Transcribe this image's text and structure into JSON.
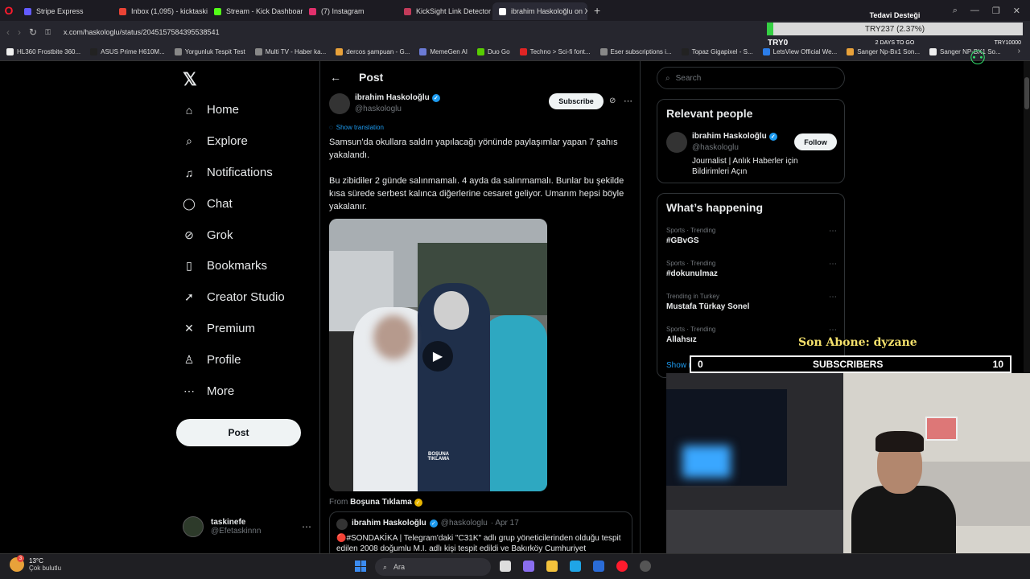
{
  "browser": {
    "tabs": [
      {
        "label": "Stripe Express",
        "color": "#635bff"
      },
      {
        "label": "Inbox (1,095) - kicktaskin...",
        "color": "#ea4335"
      },
      {
        "label": "Stream - Kick Dashboard",
        "color": "#53fc18"
      },
      {
        "label": "(7) Instagram",
        "color": "#e1306c"
      },
      {
        "label": "KickSight Link Detector",
        "color": "#c23b5a"
      },
      {
        "label": "ibrahim Haskoloğlu on X:",
        "color": "#ffffff",
        "active": true
      }
    ],
    "url": "x.com/haskologlu/status/2045157584395538541",
    "bookmarks": [
      {
        "label": "HL360 Frostbite 360...",
        "color": "#f0f0f0"
      },
      {
        "label": "ASUS Prime H610M...",
        "color": "#222"
      },
      {
        "label": "Yorgunluk Tespit Test",
        "color": "#888"
      },
      {
        "label": "Multi TV - Haber ka...",
        "color": "#888"
      },
      {
        "label": "dercos şampuan - G...",
        "color": "#e8a13a"
      },
      {
        "label": "MemeGen AI",
        "color": "#6b7bd6"
      },
      {
        "label": "Duo Go",
        "color": "#58cc02"
      },
      {
        "label": "Techno > Sci-fi font...",
        "color": "#e02424"
      },
      {
        "label": "Eser subscriptions i...",
        "color": "#888"
      },
      {
        "label": "Topaz Gigapixel - S...",
        "color": "#222"
      },
      {
        "label": "LetsView Official We...",
        "color": "#2b7de9"
      },
      {
        "label": "Sanger Np-Bx1 Son...",
        "color": "#e8a13a"
      },
      {
        "label": "Sanger NP-BX1 So...",
        "color": "#eee"
      }
    ]
  },
  "sidebar": {
    "items": [
      {
        "label": "Home",
        "icon": "⌂"
      },
      {
        "label": "Explore",
        "icon": "⌕"
      },
      {
        "label": "Notifications",
        "icon": "♫"
      },
      {
        "label": "Chat",
        "icon": "◯"
      },
      {
        "label": "Grok",
        "icon": "⊘"
      },
      {
        "label": "Bookmarks",
        "icon": "▯"
      },
      {
        "label": "Creator Studio",
        "icon": "➚"
      },
      {
        "label": "Premium",
        "icon": "✕"
      },
      {
        "label": "Profile",
        "icon": "♙"
      },
      {
        "label": "More",
        "icon": "⋯"
      }
    ],
    "post_label": "Post",
    "account": {
      "name": "taskinefe",
      "handle": "@Efetaskinnn"
    }
  },
  "main": {
    "header": "Post",
    "author": {
      "name": "ibrahim Haskoloğlu",
      "handle": "@haskologlu"
    },
    "subscribe_label": "Subscribe",
    "translate_label": "Show translation",
    "text_1": "Samsun'da okullara saldırı yapılacağı yönünde paylaşımlar yapan 7 şahıs yakalandı.",
    "text_2": "Bu zibidiler 2 günde salınmamalı. 4 ayda da salınmamalı. Bunlar bu şekilde kısa sürede serbest kalınca diğerlerine cesaret geliyor. Umarım hepsi böyle yakalanır.",
    "media_watermark": "BOŞUNA TIKLAMA",
    "from_label": "From",
    "from_source": "Boşuna Tıklama",
    "quote": {
      "name": "ibrahim Haskoloğlu",
      "handle": "@haskologlu",
      "date": "· Apr 17",
      "text": "🔴#SONDAKİKA | Telegram'daki \"C31K\" adlı grup yöneticilerinden olduğu tespit edilen 2008 doğumlu M.I. adlı kişi tespit edildi ve Bakırköy Cumhuriyet"
    }
  },
  "right": {
    "search_placeholder": "Search",
    "relevant_title": "Relevant people",
    "person": {
      "name": "ibrahim Haskoloğlu",
      "handle": "@haskologlu",
      "bio": "Journalist | Anlık Haberler için Bildirimleri Açın"
    },
    "follow_label": "Follow",
    "happening_title": "What’s happening",
    "trends": [
      {
        "category": "Sports · Trending",
        "name": "#GBvGS"
      },
      {
        "category": "Sports · Trending",
        "name": "#dokunulmaz"
      },
      {
        "category": "Trending in Turkey",
        "name": "Mustafa Türkay Sonel"
      },
      {
        "category": "Sports · Trending",
        "name": "Allahsız"
      }
    ],
    "show_more": "Show more"
  },
  "overlay": {
    "goal_title": "Tedavi Desteği",
    "goal_progress": "TRY237 (2.37%)",
    "goal_fraction": 0.0237,
    "goal_start": "TRY0",
    "goal_days": "2 DAYS TO GO",
    "goal_target": "TRY10000",
    "last_sub": "Son Abone: dyzane",
    "sub_count": "0",
    "sub_label": "SUBSCRIBERS",
    "sub_goal": "10"
  },
  "taskbar": {
    "weather_temp": "13°C",
    "weather_desc": "Çok bulutlu",
    "weather_badge": "3",
    "search_placeholder": "Ara"
  }
}
